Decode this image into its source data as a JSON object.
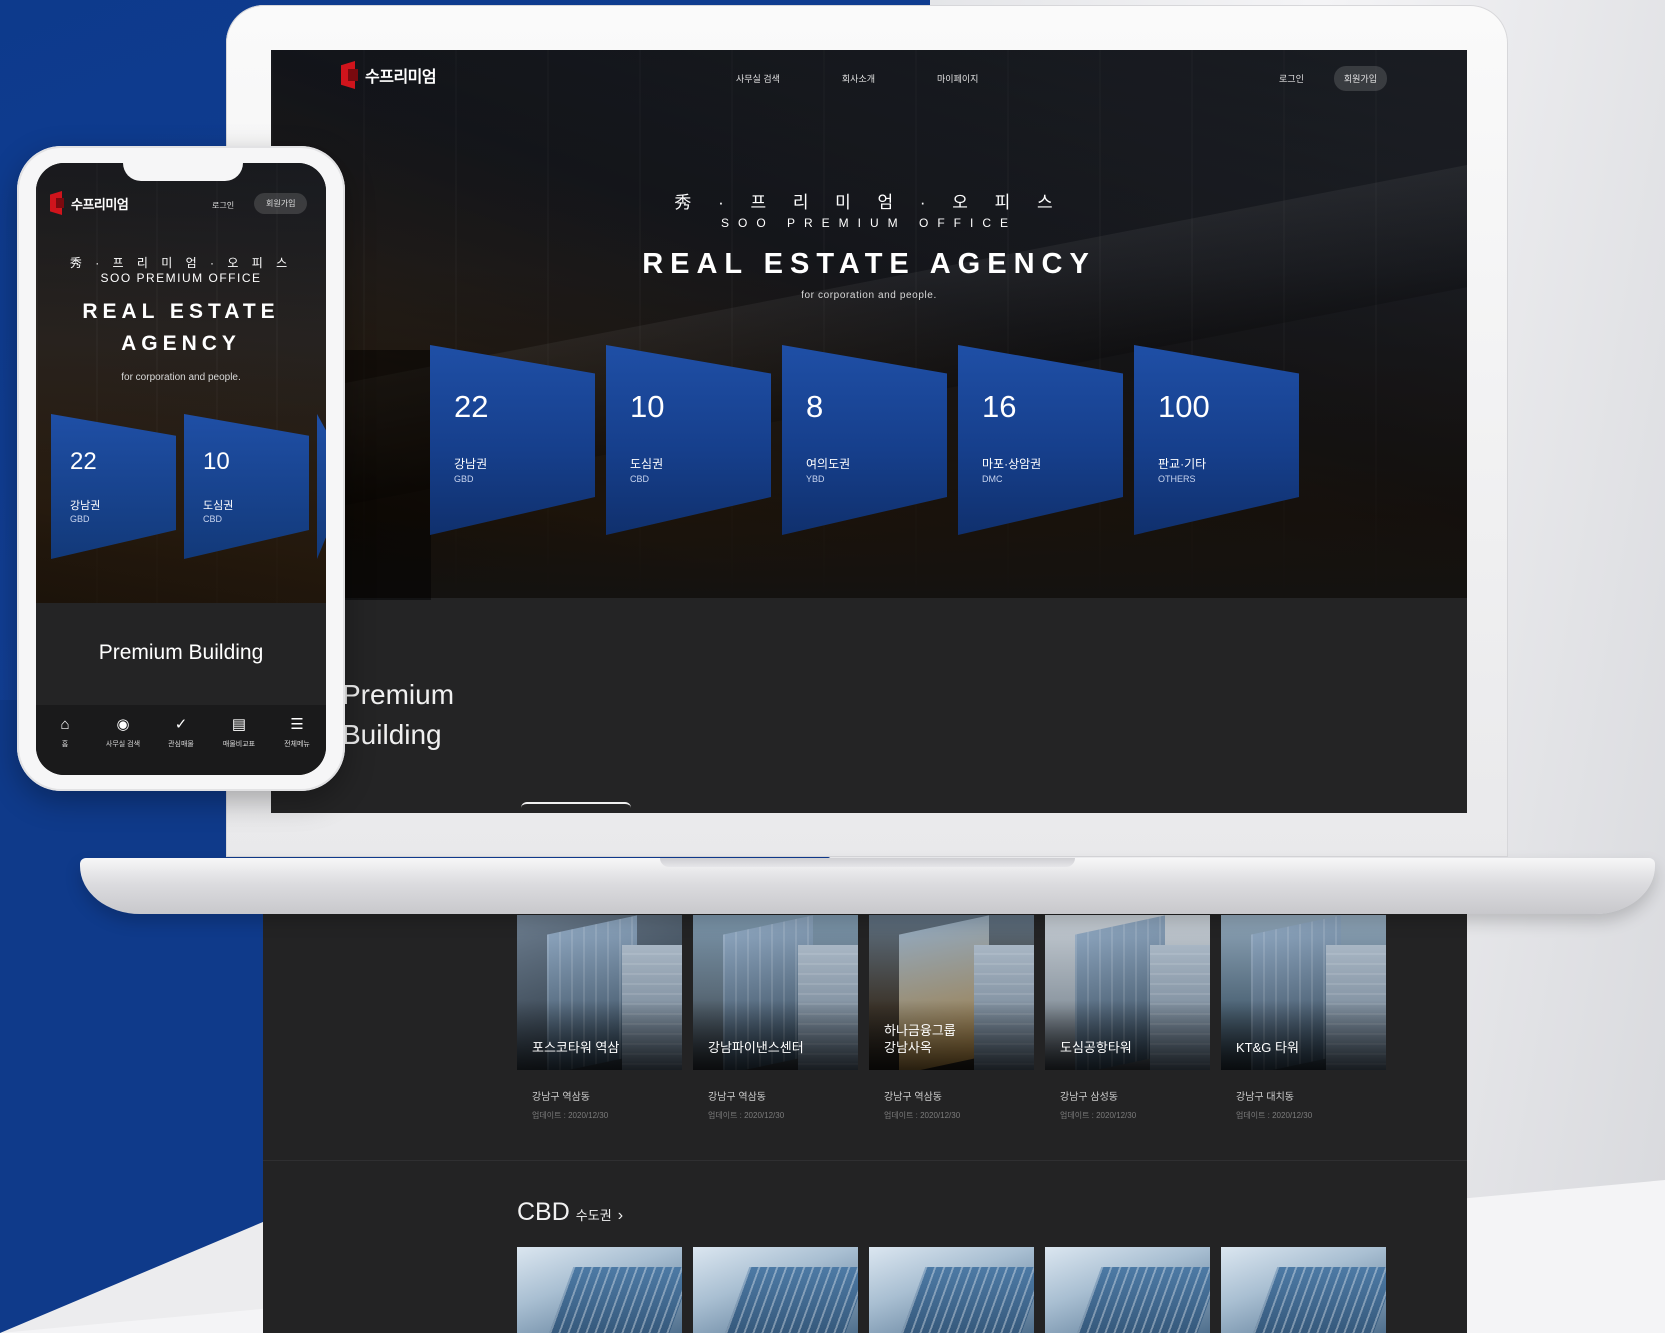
{
  "brand": {
    "name": "수프리미엄",
    "accent": "#d0141c",
    "tile_color": "#1a47a0"
  },
  "nav": {
    "links": [
      "사무실 검색",
      "회사소개",
      "마이페이지"
    ],
    "login": "로그인",
    "signup": "회원가입"
  },
  "hero": {
    "korean_title": "秀 · 프 리 미 엄 · 오 피 스",
    "english_subtitle": "SOO PREMIUM OFFICE",
    "title": "REAL ESTATE AGENCY",
    "title_line1": "REAL ESTATE",
    "title_line2": "AGENCY",
    "tagline": "for corporation and people."
  },
  "regions": [
    {
      "count": "22",
      "name": "강남권",
      "code": "GBD"
    },
    {
      "count": "10",
      "name": "도심권",
      "code": "CBD"
    },
    {
      "count": "8",
      "name": "여의도권",
      "code": "YBD"
    },
    {
      "count": "16",
      "name": "마포·상암권",
      "code": "DMC"
    },
    {
      "count": "100",
      "name": "판교·기타",
      "code": "OTHERS"
    }
  ],
  "premium": {
    "line1": "Premium",
    "line2": "Building",
    "full": "Premium Building"
  },
  "buildings": [
    {
      "name": "포스코타워 역삼",
      "address": "강남구 역삼동",
      "updated": "업데이트 : 2020/12/30"
    },
    {
      "name": "강남파이낸스센터",
      "address": "강남구 역삼동",
      "updated": "업데이트 : 2020/12/30"
    },
    {
      "name": "하나금융그룹\n강남사옥",
      "address": "강남구 역삼동",
      "updated": "업데이트 : 2020/12/30"
    },
    {
      "name": "도심공항타워",
      "address": "강남구 삼성동",
      "updated": "업데이트 : 2020/12/30"
    },
    {
      "name": "KT&G 타워",
      "address": "강남구 대치동",
      "updated": "업데이트 : 2020/12/30"
    }
  ],
  "cbd_section": {
    "title": "CBD",
    "subtitle": "수도권",
    "chevron": "›"
  },
  "mobile_tabbar": [
    {
      "label": "홈",
      "icon": "home-icon"
    },
    {
      "label": "사무실 검색",
      "icon": "search-icon"
    },
    {
      "label": "관심매물",
      "icon": "check-icon"
    },
    {
      "label": "매물비교표",
      "icon": "compare-icon"
    },
    {
      "label": "전체메뉴",
      "icon": "menu-icon"
    }
  ]
}
